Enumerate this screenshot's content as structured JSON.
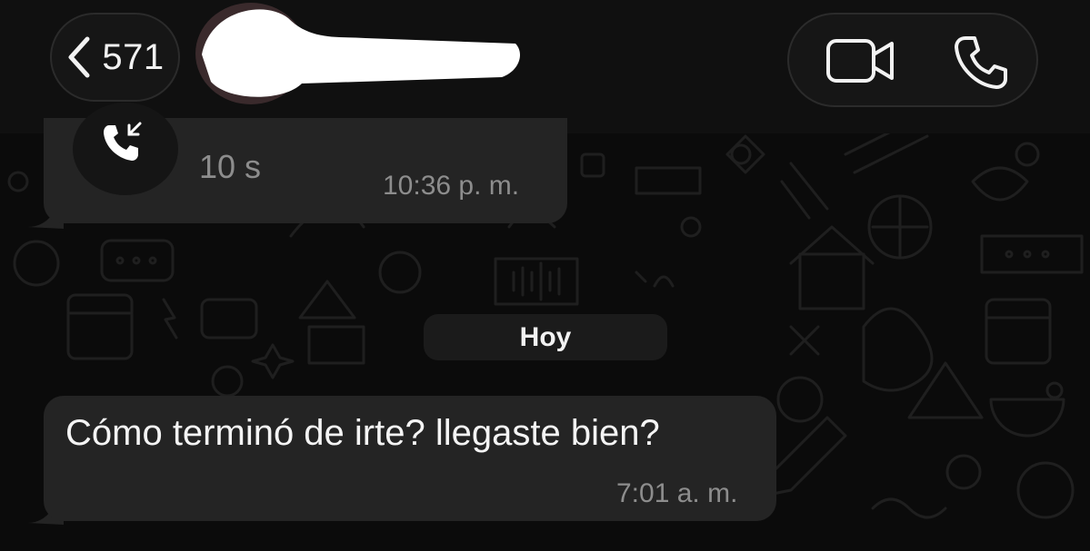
{
  "header": {
    "back_count": "571",
    "contact_name": "",
    "icons": [
      "chevron-left-icon",
      "video-camera-icon",
      "phone-icon"
    ]
  },
  "messages": [
    {
      "type": "call",
      "icon": "incoming-call-icon",
      "duration": "10 s",
      "time": "10:36 p. m."
    },
    {
      "type": "date_separator",
      "label": "Hoy"
    },
    {
      "type": "text",
      "text": "Cómo terminó de irte? llegaste bien?",
      "time": "7:01 a. m."
    }
  ],
  "colors": {
    "background": "#0b0b0b",
    "header": "#101010",
    "bubble": "#242424",
    "text": "#f4f4f4",
    "muted_text": "#8d8d8d"
  }
}
